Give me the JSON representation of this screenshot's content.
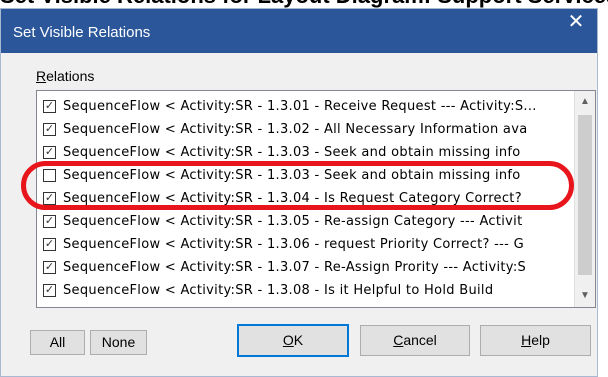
{
  "page_heading": "Set Visible Relations for Layout Diagram: Support Services",
  "dialog": {
    "title": "Set Visible Relations",
    "close_glyph": "✕"
  },
  "relations": {
    "label": "Relations",
    "label_mnemonic": "R",
    "label_rest": "elations",
    "rows": [
      {
        "checked": true,
        "text": "SequenceFlow < Activity:SR - 1.3.01 - Receive Request --- Activity:S..."
      },
      {
        "checked": true,
        "text": "SequenceFlow < Activity:SR - 1.3.02 - All Necessary Information ava"
      },
      {
        "checked": true,
        "text": "SequenceFlow < Activity:SR - 1.3.03 - Seek and obtain missing info"
      },
      {
        "checked": false,
        "text": "SequenceFlow < Activity:SR - 1.3.03 - Seek and obtain missing info"
      },
      {
        "checked": true,
        "text": "SequenceFlow < Activity:SR - 1.3.04 - Is Request Category Correct?"
      },
      {
        "checked": true,
        "text": "SequenceFlow < Activity:SR - 1.3.05 - Re-assign Category --- Activit"
      },
      {
        "checked": true,
        "text": "SequenceFlow < Activity:SR - 1.3.06 - request Priority Correct? --- G"
      },
      {
        "checked": true,
        "text": "SequenceFlow < Activity:SR - 1.3.07 - Re-Assign Prority --- Activity:S"
      },
      {
        "checked": true,
        "text": "SequenceFlow < Activity:SR - 1.3.08 - Is it Helpful to Hold Build"
      }
    ]
  },
  "buttons": {
    "all": "All",
    "none": "None",
    "ok_mnemonic": "O",
    "ok_rest": "K",
    "cancel_mnemonic": "C",
    "cancel_rest": "ancel",
    "help_mnemonic": "H",
    "help_rest": "elp"
  },
  "icons": {
    "checkbox_checked": "✓",
    "scroll_up": "▲",
    "scroll_down": "▼"
  },
  "colors": {
    "titlebar": "#2b579a",
    "highlight_ring": "#e8161c",
    "default_button_border": "#0078d7"
  }
}
